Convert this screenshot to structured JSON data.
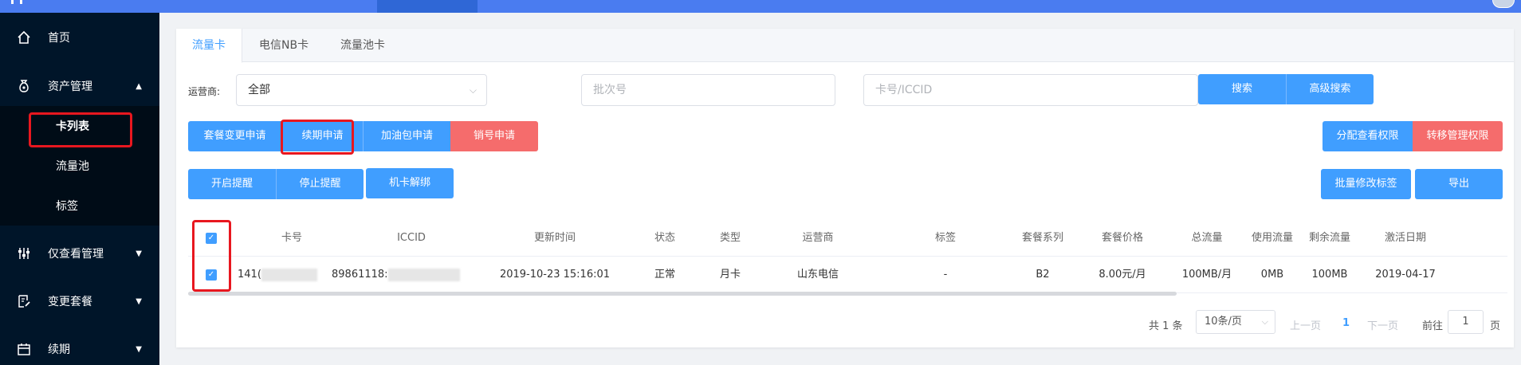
{
  "sidebar": {
    "items": [
      {
        "label": "首页",
        "icon": "home-icon"
      },
      {
        "label": "资产管理",
        "icon": "money-bag-icon"
      },
      {
        "label": "仅查看管理",
        "icon": "sliders-icon"
      },
      {
        "label": "变更套餐",
        "icon": "edit-doc-icon"
      },
      {
        "label": "续期",
        "icon": "calendar-icon"
      }
    ],
    "submenu": [
      {
        "label": "卡列表"
      },
      {
        "label": "流量池"
      },
      {
        "label": "标签"
      }
    ]
  },
  "tabs": [
    {
      "label": "流量卡"
    },
    {
      "label": "电信NB卡"
    },
    {
      "label": "流量池卡"
    }
  ],
  "filters": {
    "operator_label": "运营商:",
    "operator_value": "全部",
    "batch_placeholder": "批次号",
    "card_placeholder": "卡号/ICCID",
    "search_label": "搜索",
    "advanced_search_label": "高级搜索"
  },
  "actions": {
    "change_plan": "套餐变更申请",
    "renew": "续期申请",
    "add_fuel": "加油包申请",
    "cancel": "销号申请",
    "assign_view": "分配查看权限",
    "transfer_manage": "转移管理权限",
    "enable_alert": "开启提醒",
    "disable_alert": "停止提醒",
    "unbind": "机卡解绑",
    "batch_tag": "批量修改标签",
    "export": "导出"
  },
  "table": {
    "headers": [
      "卡号",
      "ICCID",
      "更新时间",
      "状态",
      "类型",
      "运营商",
      "标签",
      "套餐系列",
      "套餐价格",
      "总流量",
      "使用流量",
      "剩余流量",
      "激活日期"
    ],
    "rows": [
      {
        "card_no": "141(",
        "iccid": "89861118:",
        "updated": "2019-10-23 15:16:01",
        "status": "正常",
        "type": "月卡",
        "operator": "山东电信",
        "tag": "-",
        "plan_series": "B2",
        "plan_price": "8.00元/月",
        "total": "100MB/月",
        "used": "0MB",
        "remaining": "100MB",
        "activated": "2019-04-17"
      }
    ]
  },
  "pagination": {
    "total": "共 1 条",
    "page_size": "10条/页",
    "prev": "上一页",
    "current": "1",
    "next": "下一页",
    "goto_prefix": "前往",
    "goto_value": "1",
    "goto_suffix": "页"
  },
  "colors": {
    "primary": "#409eff",
    "danger": "#f56c6c",
    "sidebar": "#001529",
    "topbar": "#4a7cf0",
    "highlight": "#e8171f"
  }
}
